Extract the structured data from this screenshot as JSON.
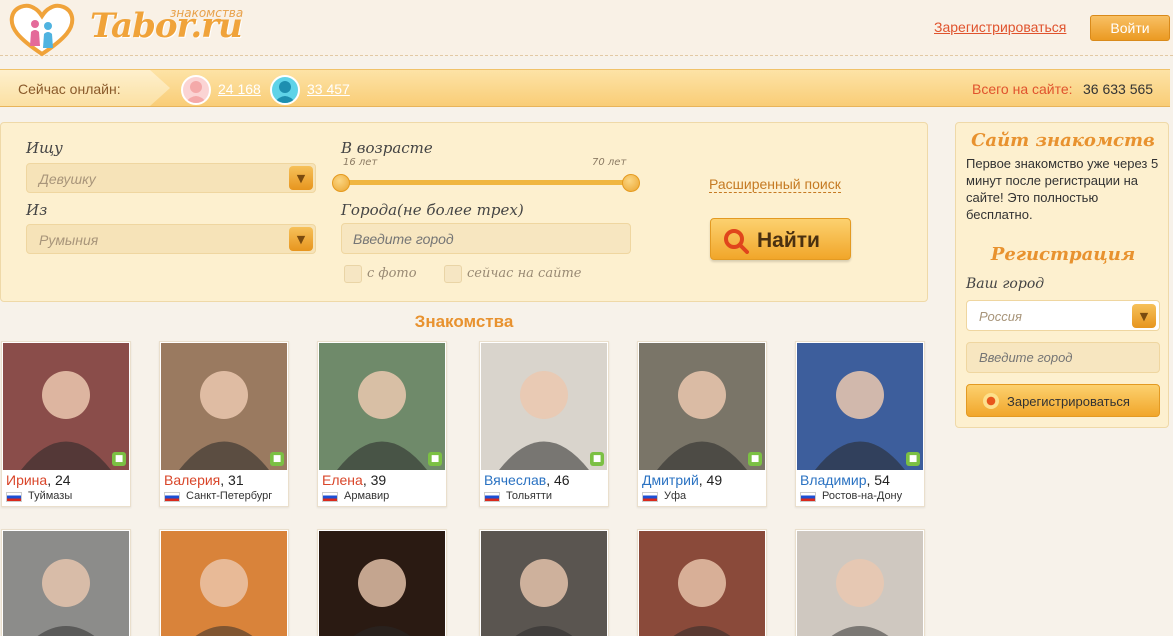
{
  "header": {
    "logo_text": "Tabor.ru",
    "logo_sub": "знакомства",
    "register_link": "Зарегистрироваться",
    "login_button": "Войти"
  },
  "online": {
    "label": "Сейчас онлайн:",
    "women_count": "24 168",
    "men_count": "33 457",
    "total_label": "Всего на сайте:",
    "total_value": "36 633 565"
  },
  "search": {
    "seeking_label": "Ищу",
    "seeking_value": "Девушку",
    "from_label": "Из",
    "from_value": "Румыния",
    "age_label": "В возрасте",
    "age_min": "16 лет",
    "age_max": "70 лет",
    "age_min_value": 16,
    "age_max_value": 70,
    "cities_label": "Города(не более трех)",
    "city_placeholder": "Введите город",
    "with_photo": "с фото",
    "online_now": "сейчас на сайте",
    "advanced_link": "Расширенный поиск",
    "find_button": "Найти"
  },
  "sidebar": {
    "title": "Сайт знакомств",
    "text": "Первое знакомство уже через 5 минут после регистрации на сайте! Это полностью бесплатно.",
    "reg_title": "Регистрация",
    "city_label": "Ваш город",
    "city_value": "Россия",
    "city_placeholder": "Введите город",
    "register_button": "Зарегистрироваться"
  },
  "section_title": "Знакомства",
  "profiles": [
    {
      "name": "Ирина",
      "age": ", 24",
      "city": "Туймазы",
      "gender": "f",
      "color": "#8a4d4a"
    },
    {
      "name": "Валерия",
      "age": ", 31",
      "city": "Санкт-Петербург",
      "gender": "f",
      "color": "#9a7a60"
    },
    {
      "name": "Елена",
      "age": ", 39",
      "city": "Армавир",
      "gender": "f",
      "color": "#6f8a6a"
    },
    {
      "name": "Вячеслав",
      "age": ", 46",
      "city": "Тольятти",
      "gender": "m",
      "color": "#d9d4cc"
    },
    {
      "name": "Дмитрий",
      "age": ", 49",
      "city": "Уфа",
      "gender": "m",
      "color": "#7a7568"
    },
    {
      "name": "Владимир",
      "age": ", 54",
      "city": "Ростов-на-Дону",
      "gender": "m",
      "color": "#3d5e9c"
    }
  ],
  "profiles_row2": [
    {
      "color": "#8c8c8a"
    },
    {
      "color": "#d9833a"
    },
    {
      "color": "#2a1a12"
    },
    {
      "color": "#5a5550"
    },
    {
      "color": "#8a4a3a"
    },
    {
      "color": "#cfc8c0"
    }
  ]
}
